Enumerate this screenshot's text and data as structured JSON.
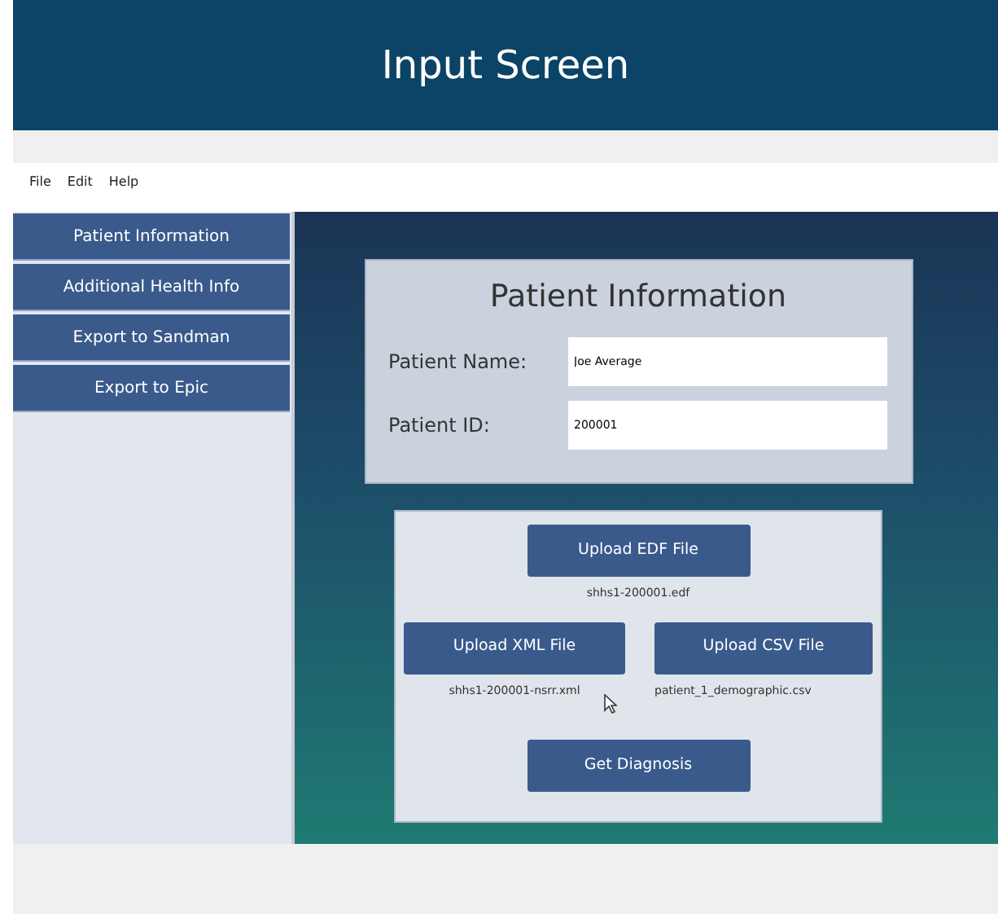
{
  "header": {
    "title": "Input Screen"
  },
  "menu": [
    "File",
    "Edit",
    "Help"
  ],
  "sidebar": {
    "items": [
      "Patient Information",
      "Additional Health Info",
      "Export to Sandman",
      "Export to Epic"
    ]
  },
  "patient_card": {
    "title": "Patient Information",
    "fields": [
      {
        "label": "Patient Name:",
        "value": "Joe Average"
      },
      {
        "label": "Patient ID:",
        "value": "200001"
      }
    ]
  },
  "uploads": {
    "edf": {
      "button": "Upload EDF File",
      "file": "shhs1-200001.edf"
    },
    "xml": {
      "button": "Upload XML File",
      "file": "shhs1-200001-nsrr.xml"
    },
    "csv": {
      "button": "Upload CSV File",
      "file": "patient_1_demographic.csv"
    },
    "diagnose": "Get Diagnosis"
  }
}
